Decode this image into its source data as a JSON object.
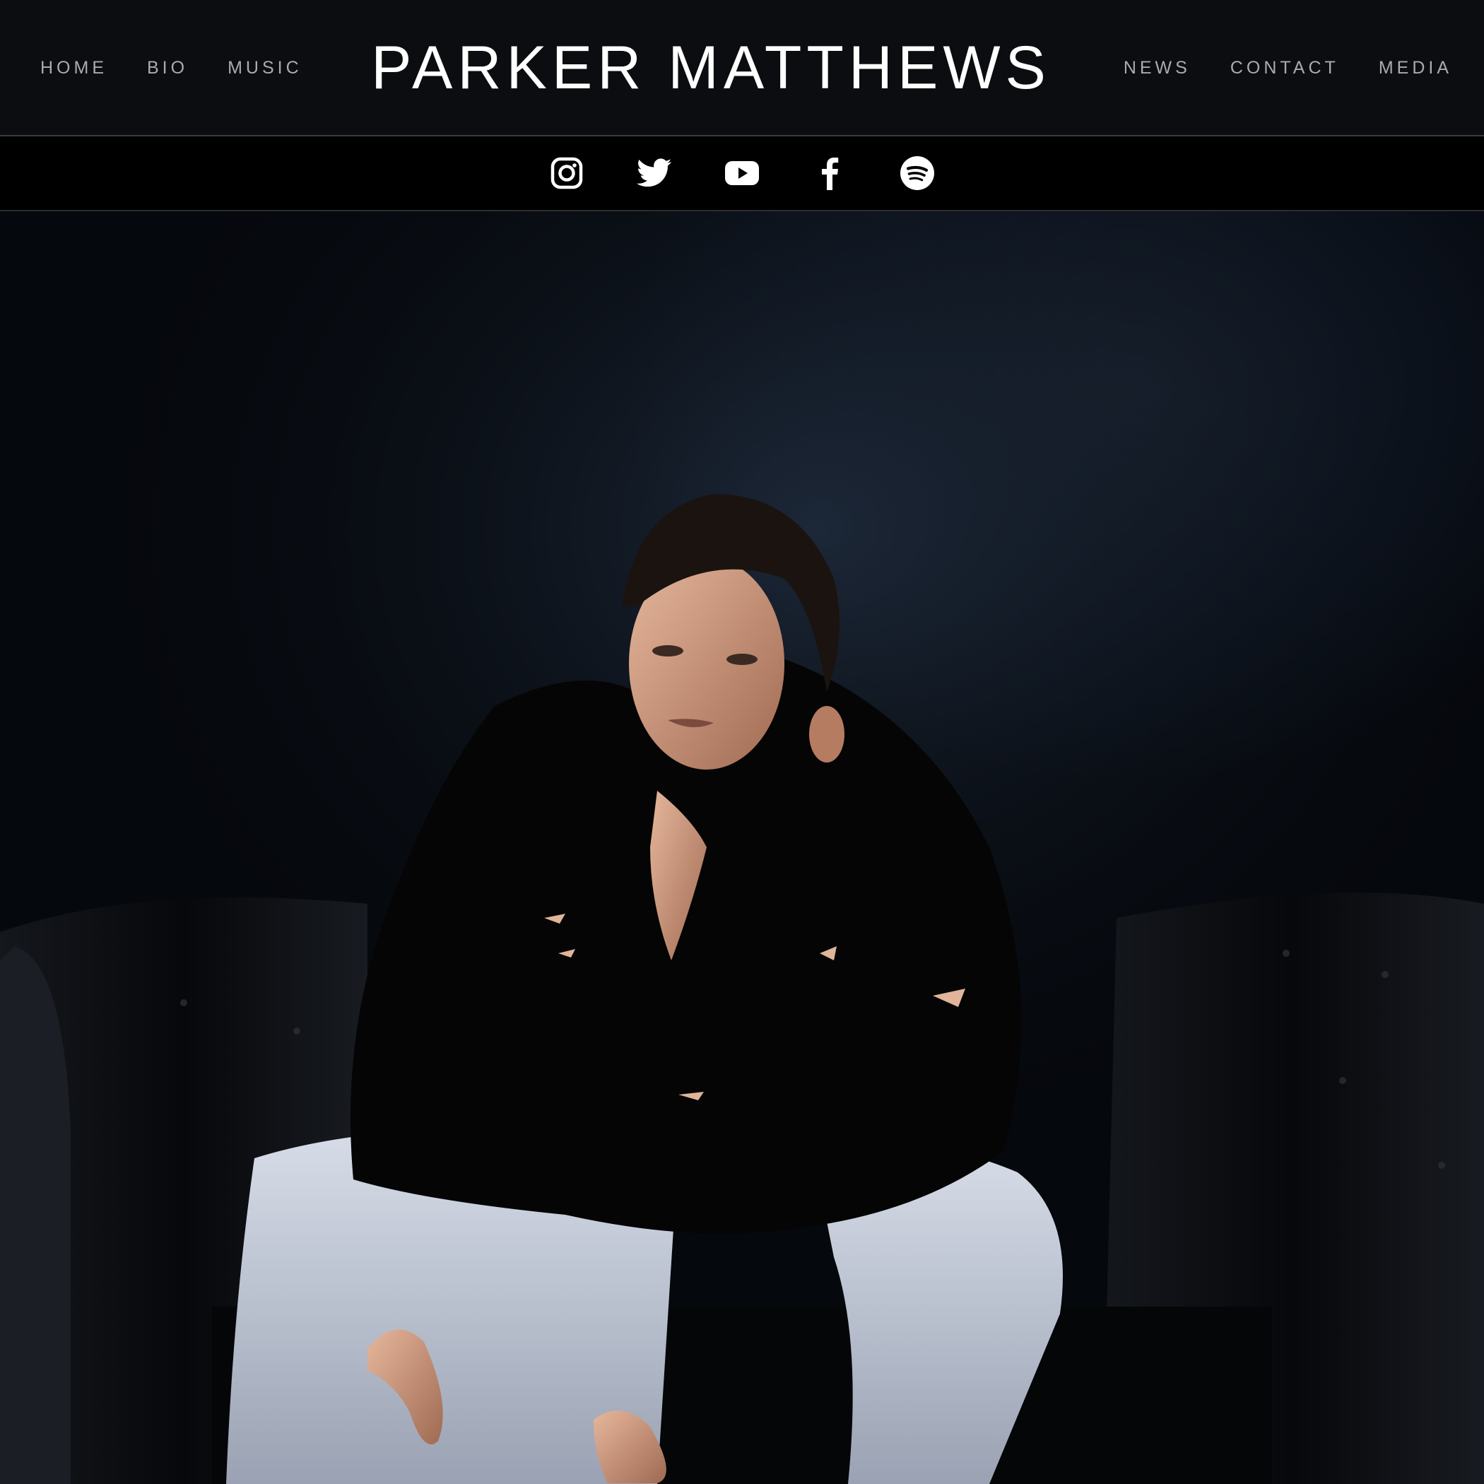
{
  "site": {
    "title": "PARKER MATTHEWS"
  },
  "nav": {
    "left": [
      {
        "label": "HOME"
      },
      {
        "label": "BIO"
      },
      {
        "label": "MUSIC"
      }
    ],
    "right": [
      {
        "label": "NEWS"
      },
      {
        "label": "CONTACT"
      },
      {
        "label": "MEDIA"
      }
    ]
  },
  "social": {
    "icons": [
      "instagram-icon",
      "twitter-icon",
      "youtube-icon",
      "facebook-icon",
      "spotify-icon"
    ]
  },
  "colors": {
    "header_bg": "#0c0d10",
    "social_bg": "#000000",
    "nav_text": "#a9abb0",
    "title_text": "#ffffff",
    "hero_bg": "#0d1420"
  }
}
